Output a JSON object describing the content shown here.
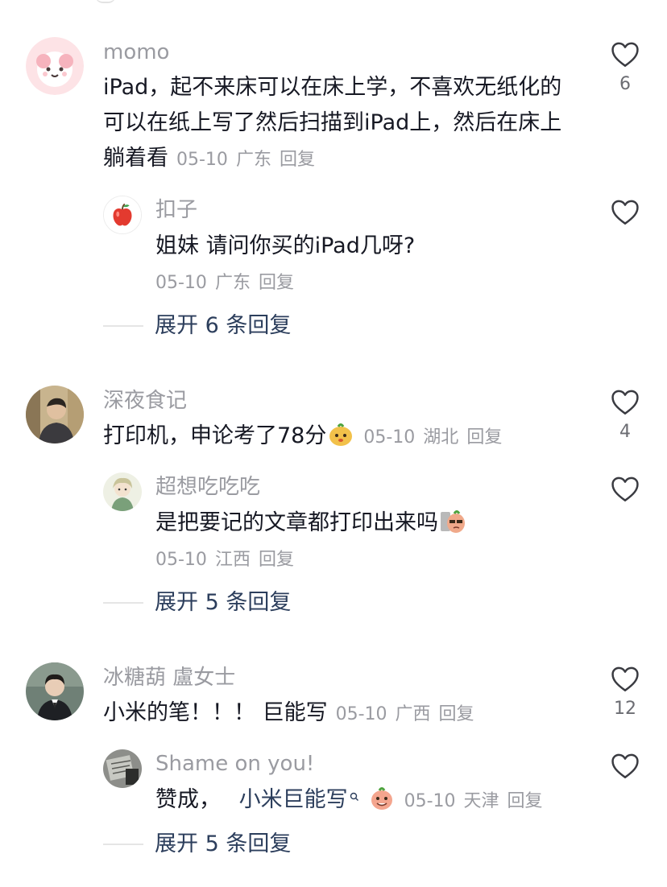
{
  "comments": [
    {
      "user": "momo",
      "text": "iPad，起不来床可以在床上学，不喜欢无纸化的可以在纸上写了然后扫描到iPad上，然后在床上躺着看",
      "date": "05-10",
      "location": "广东",
      "reply_label": "回复",
      "likes": "6",
      "reply": {
        "user": "扣子",
        "text": "姐妹 请问你买的iPad几呀?",
        "date": "05-10",
        "location": "广东",
        "reply_label": "回复"
      },
      "expand_label": "展开 6 条回复"
    },
    {
      "user": "深夜食记",
      "text": "打印机，申论考了78分",
      "date": "05-10",
      "location": "湖北",
      "reply_label": "回复",
      "likes": "4",
      "reply": {
        "user": "超想吃吃吃",
        "text": "是把要记的文章都打印出来吗",
        "date": "05-10",
        "location": "江西",
        "reply_label": "回复"
      },
      "expand_label": "展开 5 条回复"
    },
    {
      "user": "冰糖葫 盧女士",
      "text": "小米的笔！！！ 巨能写",
      "date": "05-10",
      "location": "广西",
      "reply_label": "回复",
      "likes": "12",
      "reply": {
        "user": "Shame on you!",
        "text_prefix": "赞成，",
        "mention": "小米巨能写",
        "date": "05-10",
        "location": "天津",
        "reply_label": "回复"
      },
      "expand_label": "展开 5 条回复"
    }
  ]
}
